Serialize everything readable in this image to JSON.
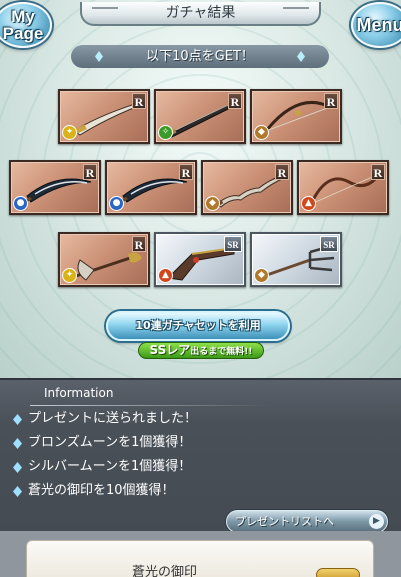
{
  "header": {
    "title": "ガチャ結果",
    "mypage_label_1": "My",
    "mypage_label_2": "Page",
    "menu_label": "Menu"
  },
  "get_banner": "以下10点をGET！",
  "items": [
    {
      "name": "curved-sword",
      "rarity": "R",
      "element": "light",
      "element_color": "#d9b21a"
    },
    {
      "name": "long-blade",
      "rarity": "R",
      "element": "wind",
      "element_color": "#3c9a2a"
    },
    {
      "name": "bow",
      "rarity": "R",
      "element": "earth",
      "element_color": "#b07a2c"
    },
    {
      "name": "winged-blade",
      "rarity": "R",
      "element": "water",
      "element_color": "#2a66c8"
    },
    {
      "name": "winged-blade",
      "rarity": "R",
      "element": "water",
      "element_color": "#2a66c8"
    },
    {
      "name": "wavy-sword",
      "rarity": "R",
      "element": "earth",
      "element_color": "#b07a2c"
    },
    {
      "name": "longbow",
      "rarity": "R",
      "element": "fire",
      "element_color": "#d2481c"
    },
    {
      "name": "axe",
      "rarity": "R",
      "element": "light",
      "element_color": "#d9b21a"
    },
    {
      "name": "gun",
      "rarity": "SR",
      "element": "fire",
      "element_color": "#d2481c"
    },
    {
      "name": "trident",
      "rarity": "SR",
      "element": "earth",
      "element_color": "#b07a2c"
    }
  ],
  "set_button": "10連ガチャセットを利用",
  "ss_ribbon": {
    "prefix": "SSレア",
    "suffix": "出るまで無料!!"
  },
  "info": {
    "title": "Information",
    "lines": [
      "プレゼントに送られました！",
      "ブロンズムーンを1個獲得！",
      "シルバームーンを1個獲得！",
      "蒼光の御印を10個獲得！"
    ],
    "present_button": "プレゼントリストへ"
  },
  "bottom_card": {
    "text": "蒼光の御印"
  }
}
